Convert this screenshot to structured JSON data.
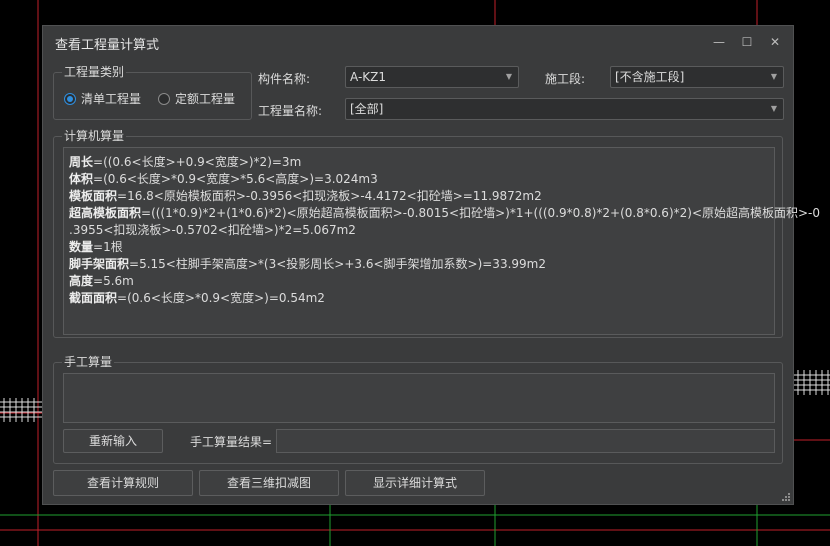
{
  "window": {
    "title": "查看工程量计算式",
    "minimize": "—",
    "maximize": "☐",
    "close": "✕"
  },
  "quantity_type": {
    "legend": "工程量类别",
    "options": [
      {
        "label": "清单工程量",
        "selected": true
      },
      {
        "label": "定额工程量",
        "selected": false
      }
    ]
  },
  "fields": {
    "component_label": "构件名称:",
    "component_value": "A-KZ1",
    "section_label": "施工段:",
    "section_value": "[不含施工段]",
    "quantity_name_label": "工程量名称:",
    "quantity_name_value": "[全部]"
  },
  "computer": {
    "legend": "计算机算量",
    "lines": [
      {
        "name": "周长",
        "expr": "=((0.6<长度>+0.9<宽度>)*2)=3m"
      },
      {
        "name": "体积",
        "expr": "=(0.6<长度>*0.9<宽度>*5.6<高度>)=3.024m3"
      },
      {
        "name": "模板面积",
        "expr": "=16.8<原始模板面积>-0.3956<扣现浇板>-4.4172<扣砼墙>=11.9872m2"
      },
      {
        "name": "超高模板面积",
        "expr": "=(((1*0.9)*2+(1*0.6)*2)<原始超高模板面积>-0.8015<扣砼墙>)*1+(((0.9*0.8)*2+(0.8*0.6)*2)<原始超高模板面积>-0"
      },
      {
        "name": "",
        "expr": ".3955<扣现浇板>-0.5702<扣砼墙>)*2=5.067m2"
      },
      {
        "name": "数量",
        "expr": "=1根"
      },
      {
        "name": "脚手架面积",
        "expr": "=5.15<柱脚手架高度>*(3<投影周长>+3.6<脚手架增加系数>)=33.99m2"
      },
      {
        "name": "高度",
        "expr": "=5.6m"
      },
      {
        "name": "截面面积",
        "expr": "=(0.6<长度>*0.9<宽度>)=0.54m2"
      }
    ]
  },
  "manual": {
    "legend": "手工算量",
    "reenter_button": "重新输入",
    "result_label": "手工算量结果="
  },
  "buttons": {
    "rules": "查看计算规则",
    "view3d": "查看三维扣减图",
    "detail": "显示详细计算式"
  },
  "colors": {
    "accent": "#2e8fe0",
    "dialog_bg": "#3a3b3c",
    "cad_red": "#c0202a",
    "cad_green": "#1fa030"
  }
}
